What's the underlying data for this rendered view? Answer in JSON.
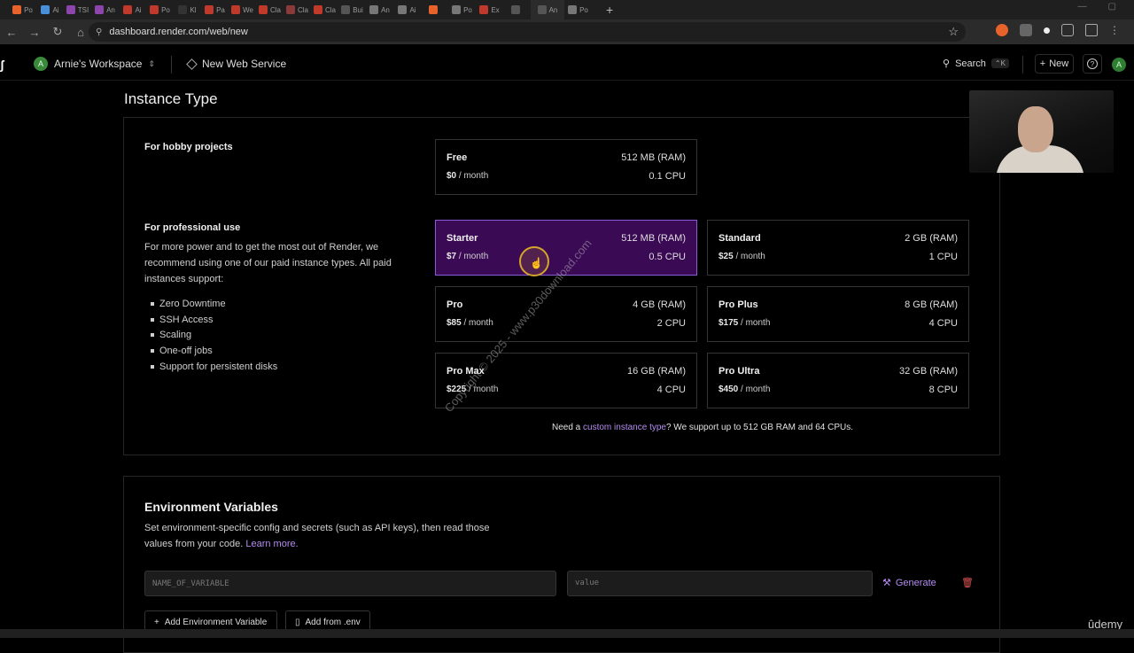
{
  "browser": {
    "url": "dashboard.render.com/web/new",
    "tab_labels": [
      "Po",
      "Ai",
      "TSI",
      "An",
      "Ai",
      "Po",
      "Kl",
      "Pa",
      "We",
      "Cla",
      "Cla",
      "Cla",
      "Bui",
      "An",
      "Ai",
      "",
      "Po",
      "Ex",
      "",
      "An",
      "Po"
    ]
  },
  "header": {
    "workspace_avatar": "A",
    "workspace_name": "Arnie's Workspace",
    "page_name": "New Web Service",
    "search_label": "Search",
    "search_shortcut": "⌃K",
    "new_label": "New",
    "help_icon": "?",
    "user_avatar": "A"
  },
  "instance": {
    "title": "Instance Type",
    "hobby_label": "For hobby projects",
    "pro_label": "For professional use",
    "pro_desc": "For more power and to get the most out of Render, we recommend using one of our paid instance types. All paid instances support:",
    "features": [
      "Zero Downtime",
      "SSH Access",
      "Scaling",
      "One-off jobs",
      "Support for persistent disks"
    ],
    "cards": [
      {
        "name": "Free",
        "price": "$0",
        "period": " / month",
        "ram": "512 MB (RAM)",
        "cpu": "0.1 CPU",
        "selected": false
      },
      {
        "name": "Starter",
        "price": "$7",
        "period": " / month",
        "ram": "512 MB (RAM)",
        "cpu": "0.5 CPU",
        "selected": true
      },
      {
        "name": "Standard",
        "price": "$25",
        "period": " / month",
        "ram": "2 GB (RAM)",
        "cpu": "1 CPU",
        "selected": false
      },
      {
        "name": "Pro",
        "price": "$85",
        "period": " / month",
        "ram": "4 GB (RAM)",
        "cpu": "2 CPU",
        "selected": false
      },
      {
        "name": "Pro Plus",
        "price": "$175",
        "period": " / month",
        "ram": "8 GB (RAM)",
        "cpu": "4 CPU",
        "selected": false
      },
      {
        "name": "Pro Max",
        "price": "$225",
        "period": " / month",
        "ram": "16 GB (RAM)",
        "cpu": "4 CPU",
        "selected": false
      },
      {
        "name": "Pro Ultra",
        "price": "$450",
        "period": " / month",
        "ram": "32 GB (RAM)",
        "cpu": "8 CPU",
        "selected": false
      }
    ],
    "need_prefix": "Need a ",
    "need_link": "custom instance type",
    "need_suffix": "? We support up to 512 GB RAM and 64 CPUs."
  },
  "watermark": "Copyright © 2025 - www.p30download.com",
  "env": {
    "title": "Environment Variables",
    "desc": "Set environment-specific config and secrets (such as API keys), then read those values from your code.",
    "learn_more": "Learn more.",
    "name_placeholder": "NAME_OF_VARIABLE",
    "value_placeholder": "value",
    "generate_label": "Generate",
    "add_env_label": "Add Environment Variable",
    "add_from_env_label": "Add from .env"
  },
  "overlay": {
    "udemy": "ûdemy"
  }
}
